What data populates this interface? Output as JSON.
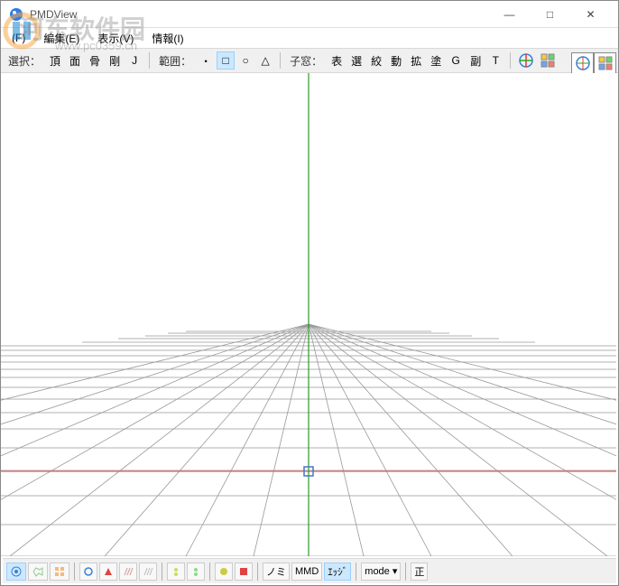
{
  "window": {
    "title": "PMDView",
    "minimize": "—",
    "maximize": "□",
    "close": "✕"
  },
  "menu": {
    "file": "(F)",
    "edit": "編集(E)",
    "view": "表示(V)",
    "info": "情報(I)"
  },
  "toolbar": {
    "select_label": "選択：",
    "vert": "頂",
    "face": "面",
    "bone": "骨",
    "rigid": "剛",
    "joint": "J",
    "range_label": "範囲：",
    "dot": "・",
    "square": "□",
    "circle": "○",
    "triangle": "△",
    "child_label": "子窓：",
    "surface": "表",
    "select_sub": "選",
    "narrow": "絞",
    "move": "動",
    "expand": "拡",
    "paint": "塗",
    "g": "G",
    "copy": "副",
    "t": "T"
  },
  "statusbar": {
    "nomi": "ノミ",
    "mmd": "MMD",
    "edge": "ｴｯｼﾞ",
    "mode": "mode",
    "dropdown": "▾",
    "ortho": "正"
  },
  "watermark": {
    "text": "河东软件园",
    "url": "www.pc0359.cn"
  }
}
